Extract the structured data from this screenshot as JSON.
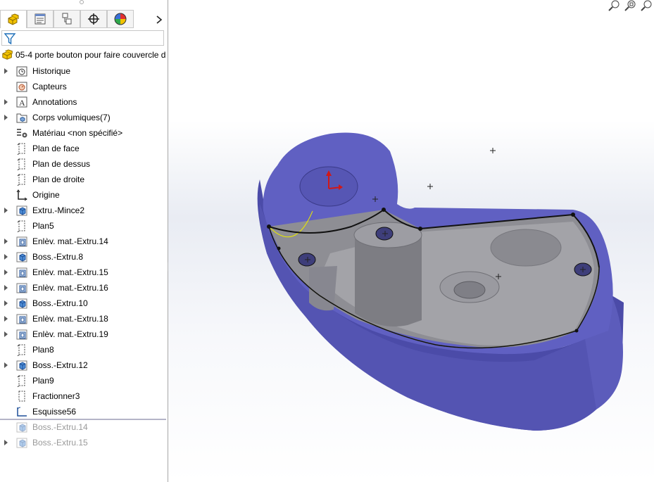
{
  "feature_manager": {
    "tabs": [
      {
        "name": "featuremanager-tab",
        "icon": "feature-tree-icon"
      },
      {
        "name": "propertymanager-tab",
        "icon": "property-list-icon"
      },
      {
        "name": "configurationmanager-tab",
        "icon": "configuration-icon"
      },
      {
        "name": "dimxpert-tab",
        "icon": "crosshair-icon"
      },
      {
        "name": "display-manager-tab",
        "icon": "appearance-pie-icon"
      }
    ],
    "more_icon": "chevron-right-icon",
    "filter_icon": "filter-funnel-icon",
    "root": {
      "label": "05-4 porte bouton pour faire couvercle d",
      "icon": "part-icon"
    },
    "items": [
      {
        "label": "Historique",
        "icon": "history-icon",
        "expandable": true
      },
      {
        "label": "Capteurs",
        "icon": "sensor-icon",
        "expandable": false
      },
      {
        "label": "Annotations",
        "icon": "annotations-icon",
        "expandable": true
      },
      {
        "label": "Corps volumiques(7)",
        "icon": "solid-bodies-icon",
        "expandable": true
      },
      {
        "label": "Matériau <non spécifié>",
        "icon": "material-icon",
        "expandable": false
      },
      {
        "label": "Plan de face",
        "icon": "plane-icon",
        "expandable": false
      },
      {
        "label": "Plan de dessus",
        "icon": "plane-icon",
        "expandable": false
      },
      {
        "label": "Plan de droite",
        "icon": "plane-icon",
        "expandable": false
      },
      {
        "label": "Origine",
        "icon": "origin-icon",
        "expandable": false
      },
      {
        "label": "Extru.-Mince2",
        "icon": "boss-extrude-icon",
        "expandable": true
      },
      {
        "label": "Plan5",
        "icon": "plane-icon",
        "expandable": false
      },
      {
        "label": "Enlèv. mat.-Extru.14",
        "icon": "cut-extrude-icon",
        "expandable": true
      },
      {
        "label": "Boss.-Extru.8",
        "icon": "boss-extrude-icon",
        "expandable": true
      },
      {
        "label": "Enlèv. mat.-Extru.15",
        "icon": "cut-extrude-icon",
        "expandable": true
      },
      {
        "label": "Enlèv. mat.-Extru.16",
        "icon": "cut-extrude-icon",
        "expandable": true
      },
      {
        "label": "Boss.-Extru.10",
        "icon": "boss-extrude-icon",
        "expandable": true
      },
      {
        "label": "Enlèv. mat.-Extru.18",
        "icon": "cut-extrude-icon",
        "expandable": true
      },
      {
        "label": "Enlèv. mat.-Extru.19",
        "icon": "cut-extrude-icon",
        "expandable": true
      },
      {
        "label": "Plan8",
        "icon": "plane-icon",
        "expandable": false
      },
      {
        "label": "Boss.-Extru.12",
        "icon": "boss-extrude-icon",
        "expandable": true
      },
      {
        "label": "Plan9",
        "icon": "plane-icon",
        "expandable": false
      },
      {
        "label": "Fractionner3",
        "icon": "split-icon",
        "expandable": false
      },
      {
        "label": "Esquisse56",
        "icon": "sketch-icon",
        "expandable": false
      },
      {
        "label": "Boss.-Extru.14",
        "icon": "boss-extrude-icon",
        "expandable": false,
        "suppressed": true
      },
      {
        "label": "Boss.-Extru.15",
        "icon": "boss-extrude-icon",
        "expandable": true,
        "suppressed": true
      }
    ]
  },
  "viewport": {
    "toolbar_icons": [
      "zoom-to-fit-icon",
      "zoom-to-area-icon",
      "previous-view-icon"
    ],
    "model_color": "#5f5fbf",
    "model_dark_color": "#4a4aa6",
    "interior_color": "#9a9a9e",
    "sketch_color": "#e8e800"
  }
}
